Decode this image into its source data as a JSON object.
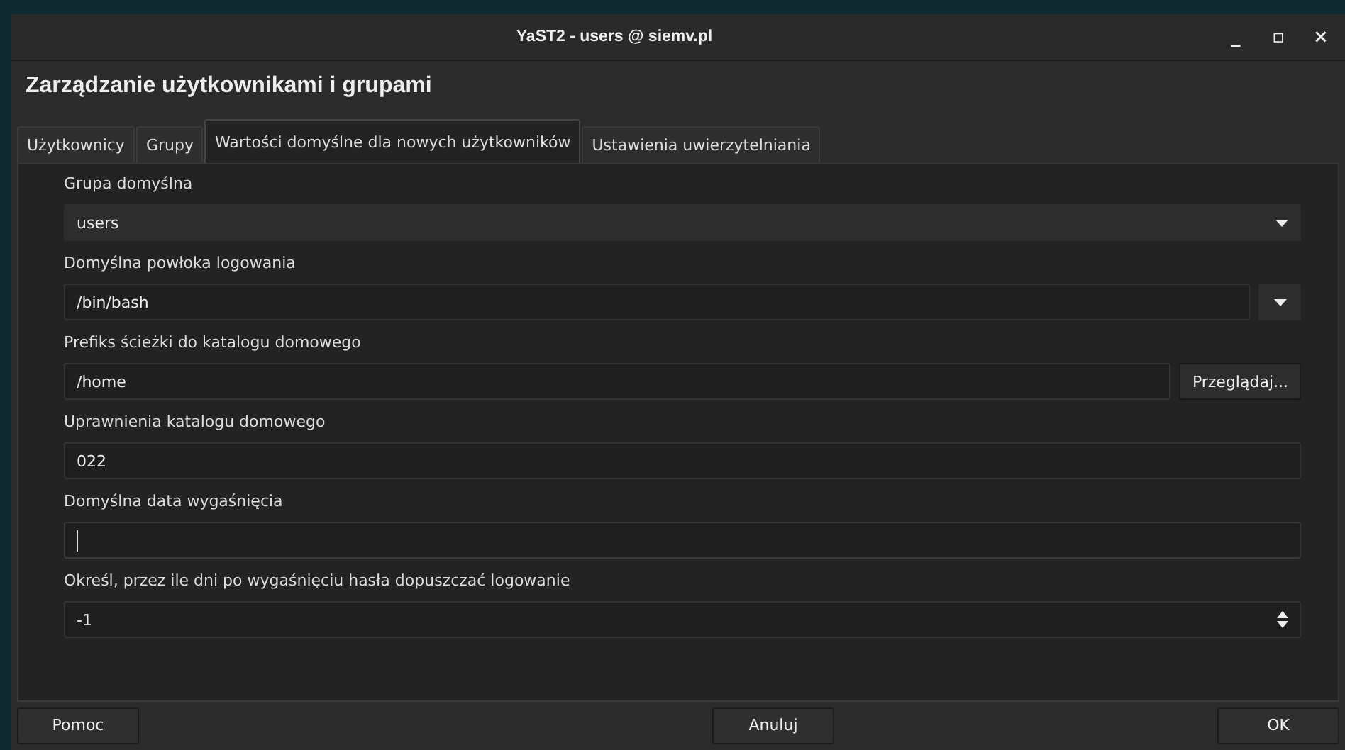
{
  "window": {
    "title": "YaST2 - users @ siemv.pl",
    "controls": [
      "_",
      "▫",
      "×"
    ]
  },
  "heading": "Zarządzanie użytkownikami i grupami",
  "tabs": [
    {
      "label": "Użytkownicy",
      "selected": false
    },
    {
      "label": "Grupy",
      "selected": false
    },
    {
      "label": "Wartości domyślne dla nowych użytkowników",
      "selected": true
    },
    {
      "label": "Ustawienia uwierzytelniania",
      "selected": false
    }
  ],
  "fields": [
    {
      "kind": "combo",
      "label": "Grupa domyślna",
      "value": "users",
      "editable": false
    },
    {
      "kind": "combo",
      "label": "Domyślna powłoka logowania",
      "value": "/bin/bash",
      "editable": true
    },
    {
      "kind": "browse",
      "label": "Prefiks ścieżki do katalogu domowego",
      "value": "/home",
      "button": "Przeglądaj..."
    },
    {
      "kind": "text",
      "label": "Uprawnienia katalogu domowego",
      "value": "022",
      "focused": false
    },
    {
      "kind": "text",
      "label": "Domyślna data wygaśnięcia",
      "focused": true
    },
    {
      "kind": "spin",
      "label": "Określ, przez ile dni po wygaśnięciu hasła dopuszczać logowanie",
      "value": "-1"
    }
  ],
  "buttons": {
    "help": "Pomoc",
    "cancel": "Anuluj",
    "ok": "OK"
  }
}
